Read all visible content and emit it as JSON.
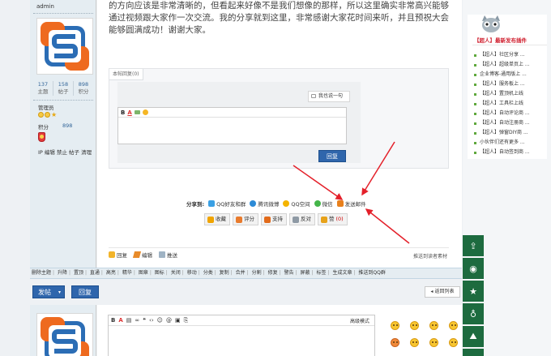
{
  "user": {
    "username": "admin",
    "stats": [
      {
        "value": "137",
        "label": "主题"
      },
      {
        "value": "158",
        "label": "帖子"
      },
      {
        "value": "898",
        "label": "积分"
      }
    ],
    "group": "管理员",
    "score_label": "积分",
    "score_value": "898",
    "ip_line": "IP 编辑 禁止 帖子 清理"
  },
  "post": {
    "text": "的方向应该是非常清晰的，但看起来好像不是我们想像的那样，所以这里确实非常高兴能够通过视频跟大家作一次交流。我的分享就到这里，非常感谢大家花时间来听，并且预祝大会能够圆满成功！谢谢大家。"
  },
  "reply_box": {
    "tab": "本帖回复(0)",
    "quick_button": "我也说一句",
    "submit": "回复"
  },
  "share": {
    "label": "分享到:",
    "items": [
      {
        "label": "QQ好友和群",
        "color": "#3aa0e4"
      },
      {
        "label": "腾讯微博",
        "color": "#2c8ad6"
      },
      {
        "label": "QQ空间",
        "color": "#f4b400"
      },
      {
        "label": "微信",
        "color": "#44b549"
      },
      {
        "label": "发送邮件",
        "color": "#e8801c"
      }
    ]
  },
  "actions": [
    {
      "label": "收藏",
      "icon": "star-icon",
      "color": "#f0a400",
      "count": ""
    },
    {
      "label": "评分",
      "icon": "rate-icon",
      "color": "#e97b2d",
      "count": ""
    },
    {
      "label": "支持",
      "icon": "thumb-up-icon",
      "color": "#e26b1b",
      "count": ""
    },
    {
      "label": "反对",
      "icon": "thumb-down-icon",
      "color": "#8f9aa5",
      "count": ""
    },
    {
      "label": "赞",
      "icon": "like-icon",
      "color": "#e7a21a",
      "count": "(0)"
    }
  ],
  "bottom_tools": [
    {
      "label": "回复",
      "icon": "reply-icon"
    },
    {
      "label": "编辑",
      "icon": "edit-icon"
    },
    {
      "label": "推送",
      "icon": "push-icon"
    }
  ],
  "push_link": "推送到读者素材",
  "mod_tools": [
    "删除主题",
    "升降",
    "置顶",
    "直通",
    "高亮",
    "精华",
    "图章",
    "图标",
    "关闭",
    "移动",
    "分类",
    "复制",
    "合并",
    "分割",
    "修复",
    "警告",
    "屏蔽",
    "标签",
    "生成文章",
    "推送到QQ群"
  ],
  "action_bar": {
    "post_button": "发帖",
    "reply_button": "回复",
    "back_button": "◂ 返回列表"
  },
  "editor2": {
    "advanced": "高级模式"
  },
  "sidebar": {
    "title": "【超人】最新发布插件",
    "items": [
      "【超人】社区分享 ...",
      "【超人】超级单页上 ...",
      "企业博客-通用版上 ...",
      "【超人】服务板上 ...",
      "【超人】置顶机上线",
      "【超人】工具栏上线",
      "【超人】自动评论商 ...",
      "【超人】自动注册商 ...",
      "【超人】弹窗DIY商 ...",
      "小伙伴们还有更多 ...",
      "【超人】自动签到商 ..."
    ]
  },
  "colors": {
    "primary_button": "#2f66ac",
    "userbar_bg": "#e5edf2",
    "side_icon_bg": "#1d6b3f",
    "arrow": "#e4202a"
  }
}
